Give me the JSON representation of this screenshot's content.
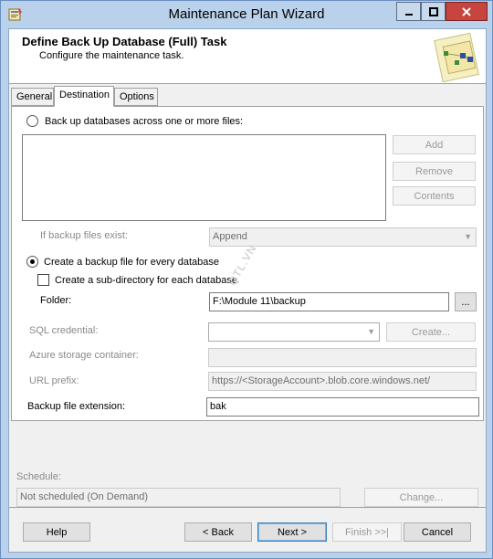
{
  "window": {
    "title": "Maintenance Plan Wizard",
    "close_color": "#c7443f",
    "icons": {
      "minimize": "minimize-icon",
      "maximize": "maximize-icon",
      "close": "close-icon",
      "app": "wizard-app-icon"
    }
  },
  "header": {
    "title": "Define Back Up Database (Full) Task",
    "subtitle": "Configure the maintenance task."
  },
  "tabs": [
    {
      "label": "General"
    },
    {
      "label": "Destination",
      "selected": true
    },
    {
      "label": "Options"
    }
  ],
  "destination": {
    "across_files_label": "Back up databases across one or more files:",
    "across_files_selected": false,
    "add_label": "Add",
    "remove_label": "Remove",
    "contents_label": "Contents",
    "if_exists_label": "If backup files exist:",
    "if_exists_value": "Append",
    "per_db_label": "Create a backup file for every database",
    "per_db_selected": true,
    "subdir_label": "Create a sub-directory for each database",
    "subdir_checked": false,
    "folder_label": "Folder:",
    "folder_value": "F:\\Module 11\\backup",
    "browse_label": "...",
    "sql_credential_label": "SQL credential:",
    "sql_credential_value": "",
    "create_label": "Create...",
    "azure_container_label": "Azure storage container:",
    "azure_container_value": "",
    "url_prefix_label": "URL prefix:",
    "url_prefix_value": "https://<StorageAccount>.blob.core.windows.net/",
    "extension_label": "Backup file extension:",
    "extension_value": "bak"
  },
  "watermark": "QTL.VN",
  "schedule": {
    "label": "Schedule:",
    "value": "Not scheduled (On Demand)",
    "change_label": "Change..."
  },
  "footer": {
    "help_label": "Help",
    "back_label": "< Back",
    "next_label": "Next >",
    "finish_label": "Finish >>|",
    "cancel_label": "Cancel"
  }
}
